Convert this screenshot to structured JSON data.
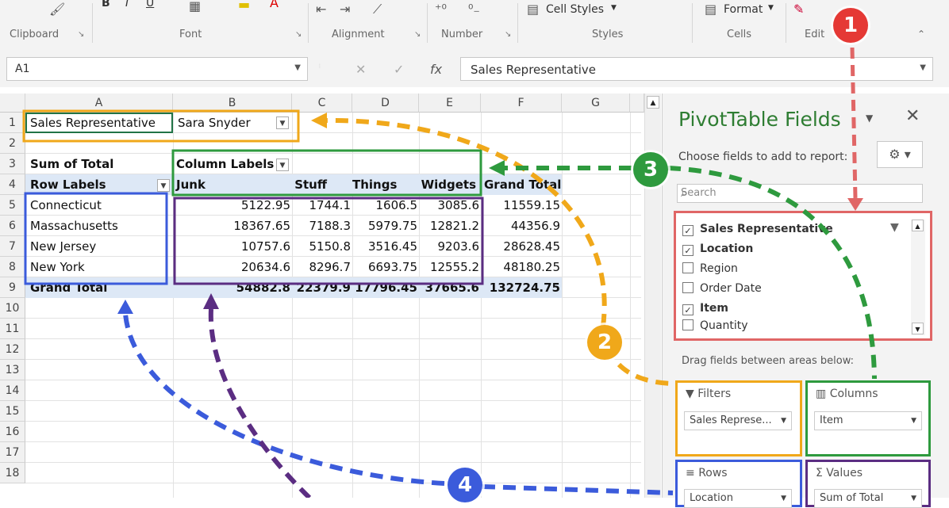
{
  "ribbon": {
    "groups": [
      "Clipboard",
      "Font",
      "Alignment",
      "Number",
      "Styles",
      "Cells",
      "Edit"
    ],
    "cell_styles_label": "Cell Styles",
    "format_label": "Format",
    "font_buttons": [
      "B",
      "I",
      "U"
    ]
  },
  "formula_bar": {
    "name_box": "A1",
    "formula": "Sales Representative",
    "fx": "fx",
    "cancel": "✕",
    "enter": "✓"
  },
  "grid": {
    "columns": [
      "A",
      "B",
      "C",
      "D",
      "E",
      "F",
      "G"
    ],
    "rows": [
      "1",
      "2",
      "3",
      "4",
      "5",
      "6",
      "7",
      "8",
      "9",
      "10",
      "11",
      "12",
      "13",
      "14",
      "15",
      "16",
      "17",
      "18"
    ],
    "filter": {
      "label": "Sales Representative",
      "value": "Sara Snyder"
    },
    "sum_label": "Sum of Total",
    "column_labels": "Column Labels",
    "row_labels": "Row Labels",
    "headers": [
      "Junk",
      "Stuff",
      "Things",
      "Widgets",
      "Grand Total"
    ],
    "data_rows": [
      {
        "label": "Connecticut",
        "values": [
          "5122.95",
          "1744.1",
          "1606.5",
          "3085.6",
          "11559.15"
        ]
      },
      {
        "label": "Massachusetts",
        "values": [
          "18367.65",
          "7188.3",
          "5979.75",
          "12821.2",
          "44356.9"
        ]
      },
      {
        "label": "New Jersey",
        "values": [
          "10757.6",
          "5150.8",
          "3516.45",
          "9203.6",
          "28628.45"
        ]
      },
      {
        "label": "New York",
        "values": [
          "20634.6",
          "8296.7",
          "6693.75",
          "12555.2",
          "48180.25"
        ]
      }
    ],
    "grand_total": {
      "label": "Grand Total",
      "values": [
        "54882.8",
        "22379.9",
        "17796.45",
        "37665.6",
        "132724.75"
      ]
    }
  },
  "pane": {
    "title": "PivotTable Fields",
    "choose": "Choose fields to add to report:",
    "search_placeholder": "Search",
    "fields": [
      {
        "label": "Sales Representative",
        "checked": true
      },
      {
        "label": "Location",
        "checked": true
      },
      {
        "label": "Region",
        "checked": false
      },
      {
        "label": "Order Date",
        "checked": false
      },
      {
        "label": "Item",
        "checked": true
      },
      {
        "label": "Quantity",
        "checked": false
      }
    ],
    "drag_text": "Drag fields between areas below:",
    "areas": {
      "filters": {
        "title": "Filters",
        "item": "Sales Represe..."
      },
      "columns": {
        "title": "Columns",
        "item": "Item"
      },
      "rows": {
        "title": "Rows",
        "item": "Location"
      },
      "values": {
        "title": "Values",
        "item": "Sum of Total"
      }
    }
  },
  "callouts": [
    "1",
    "2",
    "3",
    "4"
  ],
  "colors": {
    "red": "#e06666",
    "orange": "#f0a81a",
    "green": "#2e9a3e",
    "blue": "#3b5bdb",
    "purple": "#5b2d82",
    "pane_title": "#2e7d32",
    "total_band": "#dde8f6"
  }
}
